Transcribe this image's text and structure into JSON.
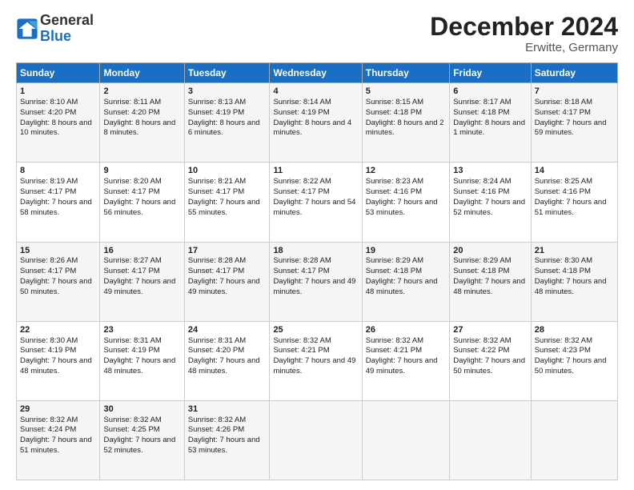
{
  "header": {
    "logo_line1": "General",
    "logo_line2": "Blue",
    "month": "December 2024",
    "location": "Erwitte, Germany"
  },
  "days_of_week": [
    "Sunday",
    "Monday",
    "Tuesday",
    "Wednesday",
    "Thursday",
    "Friday",
    "Saturday"
  ],
  "weeks": [
    [
      {
        "day": "1",
        "sunrise": "Sunrise: 8:10 AM",
        "sunset": "Sunset: 4:20 PM",
        "daylight": "Daylight: 8 hours and 10 minutes."
      },
      {
        "day": "2",
        "sunrise": "Sunrise: 8:11 AM",
        "sunset": "Sunset: 4:20 PM",
        "daylight": "Daylight: 8 hours and 8 minutes."
      },
      {
        "day": "3",
        "sunrise": "Sunrise: 8:13 AM",
        "sunset": "Sunset: 4:19 PM",
        "daylight": "Daylight: 8 hours and 6 minutes."
      },
      {
        "day": "4",
        "sunrise": "Sunrise: 8:14 AM",
        "sunset": "Sunset: 4:19 PM",
        "daylight": "Daylight: 8 hours and 4 minutes."
      },
      {
        "day": "5",
        "sunrise": "Sunrise: 8:15 AM",
        "sunset": "Sunset: 4:18 PM",
        "daylight": "Daylight: 8 hours and 2 minutes."
      },
      {
        "day": "6",
        "sunrise": "Sunrise: 8:17 AM",
        "sunset": "Sunset: 4:18 PM",
        "daylight": "Daylight: 8 hours and 1 minute."
      },
      {
        "day": "7",
        "sunrise": "Sunrise: 8:18 AM",
        "sunset": "Sunset: 4:17 PM",
        "daylight": "Daylight: 7 hours and 59 minutes."
      }
    ],
    [
      {
        "day": "8",
        "sunrise": "Sunrise: 8:19 AM",
        "sunset": "Sunset: 4:17 PM",
        "daylight": "Daylight: 7 hours and 58 minutes."
      },
      {
        "day": "9",
        "sunrise": "Sunrise: 8:20 AM",
        "sunset": "Sunset: 4:17 PM",
        "daylight": "Daylight: 7 hours and 56 minutes."
      },
      {
        "day": "10",
        "sunrise": "Sunrise: 8:21 AM",
        "sunset": "Sunset: 4:17 PM",
        "daylight": "Daylight: 7 hours and 55 minutes."
      },
      {
        "day": "11",
        "sunrise": "Sunrise: 8:22 AM",
        "sunset": "Sunset: 4:17 PM",
        "daylight": "Daylight: 7 hours and 54 minutes."
      },
      {
        "day": "12",
        "sunrise": "Sunrise: 8:23 AM",
        "sunset": "Sunset: 4:16 PM",
        "daylight": "Daylight: 7 hours and 53 minutes."
      },
      {
        "day": "13",
        "sunrise": "Sunrise: 8:24 AM",
        "sunset": "Sunset: 4:16 PM",
        "daylight": "Daylight: 7 hours and 52 minutes."
      },
      {
        "day": "14",
        "sunrise": "Sunrise: 8:25 AM",
        "sunset": "Sunset: 4:16 PM",
        "daylight": "Daylight: 7 hours and 51 minutes."
      }
    ],
    [
      {
        "day": "15",
        "sunrise": "Sunrise: 8:26 AM",
        "sunset": "Sunset: 4:17 PM",
        "daylight": "Daylight: 7 hours and 50 minutes."
      },
      {
        "day": "16",
        "sunrise": "Sunrise: 8:27 AM",
        "sunset": "Sunset: 4:17 PM",
        "daylight": "Daylight: 7 hours and 49 minutes."
      },
      {
        "day": "17",
        "sunrise": "Sunrise: 8:28 AM",
        "sunset": "Sunset: 4:17 PM",
        "daylight": "Daylight: 7 hours and 49 minutes."
      },
      {
        "day": "18",
        "sunrise": "Sunrise: 8:28 AM",
        "sunset": "Sunset: 4:17 PM",
        "daylight": "Daylight: 7 hours and 49 minutes."
      },
      {
        "day": "19",
        "sunrise": "Sunrise: 8:29 AM",
        "sunset": "Sunset: 4:18 PM",
        "daylight": "Daylight: 7 hours and 48 minutes."
      },
      {
        "day": "20",
        "sunrise": "Sunrise: 8:29 AM",
        "sunset": "Sunset: 4:18 PM",
        "daylight": "Daylight: 7 hours and 48 minutes."
      },
      {
        "day": "21",
        "sunrise": "Sunrise: 8:30 AM",
        "sunset": "Sunset: 4:18 PM",
        "daylight": "Daylight: 7 hours and 48 minutes."
      }
    ],
    [
      {
        "day": "22",
        "sunrise": "Sunrise: 8:30 AM",
        "sunset": "Sunset: 4:19 PM",
        "daylight": "Daylight: 7 hours and 48 minutes."
      },
      {
        "day": "23",
        "sunrise": "Sunrise: 8:31 AM",
        "sunset": "Sunset: 4:19 PM",
        "daylight": "Daylight: 7 hours and 48 minutes."
      },
      {
        "day": "24",
        "sunrise": "Sunrise: 8:31 AM",
        "sunset": "Sunset: 4:20 PM",
        "daylight": "Daylight: 7 hours and 48 minutes."
      },
      {
        "day": "25",
        "sunrise": "Sunrise: 8:32 AM",
        "sunset": "Sunset: 4:21 PM",
        "daylight": "Daylight: 7 hours and 49 minutes."
      },
      {
        "day": "26",
        "sunrise": "Sunrise: 8:32 AM",
        "sunset": "Sunset: 4:21 PM",
        "daylight": "Daylight: 7 hours and 49 minutes."
      },
      {
        "day": "27",
        "sunrise": "Sunrise: 8:32 AM",
        "sunset": "Sunset: 4:22 PM",
        "daylight": "Daylight: 7 hours and 50 minutes."
      },
      {
        "day": "28",
        "sunrise": "Sunrise: 8:32 AM",
        "sunset": "Sunset: 4:23 PM",
        "daylight": "Daylight: 7 hours and 50 minutes."
      }
    ],
    [
      {
        "day": "29",
        "sunrise": "Sunrise: 8:32 AM",
        "sunset": "Sunset: 4:24 PM",
        "daylight": "Daylight: 7 hours and 51 minutes."
      },
      {
        "day": "30",
        "sunrise": "Sunrise: 8:32 AM",
        "sunset": "Sunset: 4:25 PM",
        "daylight": "Daylight: 7 hours and 52 minutes."
      },
      {
        "day": "31",
        "sunrise": "Sunrise: 8:32 AM",
        "sunset": "Sunset: 4:26 PM",
        "daylight": "Daylight: 7 hours and 53 minutes."
      },
      null,
      null,
      null,
      null
    ]
  ]
}
